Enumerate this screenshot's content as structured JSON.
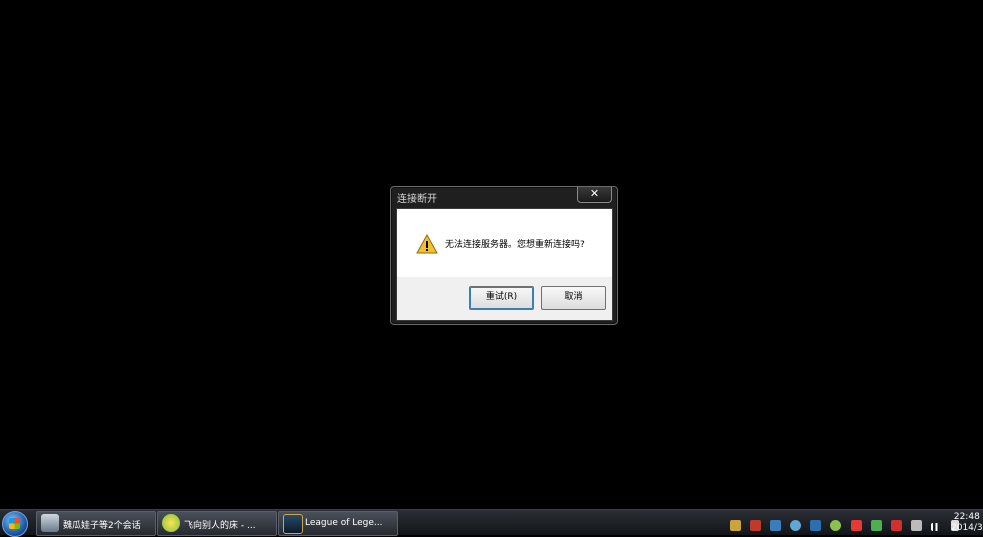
{
  "dialog": {
    "title": "连接断开",
    "close_glyph": "✕",
    "message": "无法连接服务器。您想重新连接吗?",
    "retry_label": "重试(R)",
    "cancel_label": "取消"
  },
  "taskbar": {
    "tasks": [
      {
        "label": "魏瓜娃子等2个会话"
      },
      {
        "label": "飞向别人的床 - ..."
      },
      {
        "label": "League of Lege..."
      }
    ],
    "clock_time": "22:48",
    "clock_date": "2014/3"
  },
  "colors": {
    "accent": "#3c7fb1",
    "warning": "#f2c12e"
  }
}
